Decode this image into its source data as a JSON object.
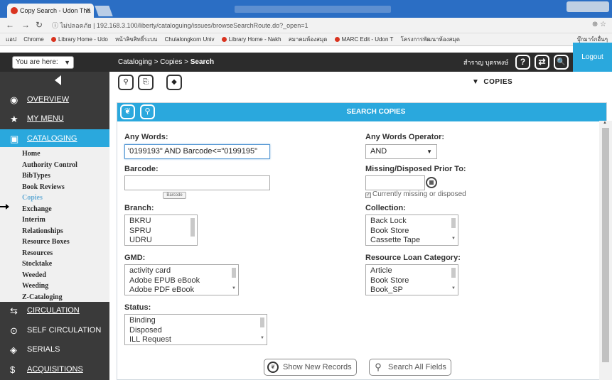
{
  "browser": {
    "tab_title": "Copy Search - Udon Tha",
    "tab_close": "×",
    "url": "192.168.3.100/liberty/cataloguing/issues/browseSearchRoute.do?_open=1",
    "url_prefix": "ⓘ ไม่ปลอดภัย |",
    "bookmarks": [
      "แอป",
      "Chrome",
      "Library Home - Udo",
      "หน้าลิขสิทธิ์ระบบ",
      "Chulalongkorn Univ",
      "Library Home - Nakh",
      "สมาคมห้องสมุด",
      "MARC Edit - Udon T",
      "โครงการพัฒนาห้องสมุด",
      "บุ๊กมาร์กอื่นๆ"
    ]
  },
  "header": {
    "you_are_here": "You are here:",
    "breadcrumb": "Cataloging > Copies > ",
    "breadcrumb_current": "Search",
    "user_name": "สำราญ บุตรพงษ์",
    "help_icon": "?",
    "swap_icon": "⇄",
    "search_icon": "🔍",
    "logout": "Logout"
  },
  "sidebar": {
    "items": [
      {
        "label": "Overview",
        "icon": "◉"
      },
      {
        "label": "My Menu",
        "icon": "★"
      },
      {
        "label": "Cataloging",
        "icon": "▣"
      },
      {
        "label": "Circulation",
        "icon": "⇆"
      },
      {
        "label": "Self Circulation",
        "icon": "⊙"
      },
      {
        "label": "Serials",
        "icon": "◈"
      },
      {
        "label": "Acquisitions",
        "icon": "$"
      }
    ],
    "submenu": [
      "Home",
      "Authority Control",
      "BibTypes",
      "Book Reviews",
      "Copies",
      "Exchange",
      "Interim",
      "Relationships",
      "Resource Boxes",
      "Resources",
      "Stocktake",
      "Weeded",
      "Weeding",
      "Z-Cataloging"
    ]
  },
  "toolbar": {
    "copies_label": "COPIES"
  },
  "panel": {
    "title": "SEARCH COPIES",
    "any_words_label": "Any Words:",
    "any_words_value": "'0199193\" AND Barcode<=\"0199195\"",
    "any_words_operator_label": "Any Words Operator:",
    "operator_value": "AND",
    "barcode_label": "Barcode:",
    "barcode_button": "Barcode",
    "missing_label": "Missing/Disposed Prior To:",
    "missing_check_label": "Currently missing or disposed",
    "branch_label": "Branch:",
    "branch_options": [
      "BKRU",
      "SPRU",
      "UDRU"
    ],
    "collection_label": "Collection:",
    "collection_options": [
      "Back Lock",
      "Book Store",
      "Cassette Tape"
    ],
    "gmd_label": "GMD:",
    "gmd_options": [
      "activity card",
      "Adobe EPUB eBook",
      "Adobe PDF eBook"
    ],
    "loan_category_label": "Resource Loan Category:",
    "loan_options": [
      "Article",
      "Book Store",
      "Book_SP"
    ],
    "status_label": "Status:",
    "status_options": [
      "Binding",
      "Disposed",
      "ILL Request"
    ],
    "show_new_records": "Show New Records",
    "search_all_fields": "Search All Fields"
  }
}
